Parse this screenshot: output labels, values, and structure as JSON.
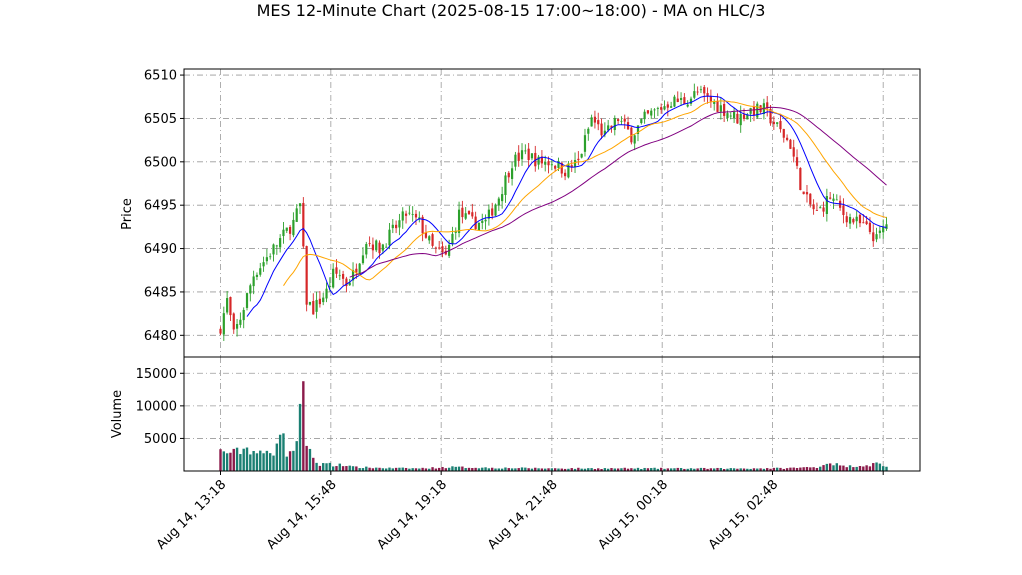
{
  "chart_data": {
    "type": "candlestick",
    "title": "MES 12-Minute Chart (2025-08-15 17:00~18:00) - MA on HLC/3",
    "price_panel": {
      "ylabel": "Price",
      "yticks": [
        6480,
        6485,
        6490,
        6495,
        6500,
        6505,
        6510
      ],
      "ylim": [
        6477.5,
        6510.7
      ],
      "grid": true
    },
    "volume_panel": {
      "ylabel": "Volume",
      "yticks": [
        5000,
        10000,
        15000
      ],
      "ylim": [
        0,
        17500
      ],
      "grid": true
    },
    "xticks": [
      "Aug 14, 13:18",
      "Aug 14, 15:48",
      "Aug 14, 19:18",
      "Aug 14, 21:48",
      "Aug 15, 00:18",
      "Aug 15, 02:48"
    ],
    "colors": {
      "up": "#2ca02c",
      "down": "#d62728",
      "volume_up": "#1a7f72",
      "volume_down": "#8b1a4a",
      "ma_fast": "#0000ff",
      "ma_mid": "#ffa500",
      "ma_slow": "#800080"
    },
    "close_anchors": [
      [
        0,
        6481
      ],
      [
        2,
        6484
      ],
      [
        4,
        6480
      ],
      [
        6,
        6482
      ],
      [
        10,
        6487
      ],
      [
        14,
        6489
      ],
      [
        18,
        6491
      ],
      [
        22,
        6493
      ],
      [
        24,
        6495
      ],
      [
        26,
        6484
      ],
      [
        28,
        6483
      ],
      [
        30,
        6484
      ],
      [
        32,
        6485
      ],
      [
        34,
        6487
      ],
      [
        36,
        6487
      ],
      [
        38,
        6486
      ],
      [
        40,
        6487
      ],
      [
        44,
        6491
      ],
      [
        48,
        6490
      ],
      [
        52,
        6492
      ],
      [
        56,
        6494
      ],
      [
        60,
        6493
      ],
      [
        64,
        6490
      ],
      [
        68,
        6489
      ],
      [
        72,
        6494
      ],
      [
        76,
        6493
      ],
      [
        80,
        6493
      ],
      [
        84,
        6496
      ],
      [
        88,
        6500
      ],
      [
        92,
        6501
      ],
      [
        96,
        6500
      ],
      [
        100,
        6500
      ],
      [
        104,
        6499
      ],
      [
        108,
        6500
      ],
      [
        112,
        6505
      ],
      [
        116,
        6503
      ],
      [
        120,
        6505
      ],
      [
        124,
        6503
      ],
      [
        128,
        6505
      ],
      [
        132,
        6506
      ],
      [
        136,
        6507
      ],
      [
        140,
        6507
      ],
      [
        144,
        6508
      ],
      [
        148,
        6507
      ],
      [
        152,
        6506
      ],
      [
        156,
        6505
      ],
      [
        160,
        6506
      ],
      [
        164,
        6506
      ],
      [
        168,
        6504
      ],
      [
        172,
        6502
      ],
      [
        176,
        6496
      ],
      [
        180,
        6494
      ],
      [
        184,
        6496
      ],
      [
        188,
        6494
      ],
      [
        192,
        6493
      ],
      [
        196,
        6492
      ],
      [
        198,
        6491
      ],
      [
        201,
        6493
      ]
    ],
    "volume_anchors": [
      [
        0,
        3000
      ],
      [
        4,
        2800
      ],
      [
        8,
        3500
      ],
      [
        12,
        2600
      ],
      [
        16,
        3000
      ],
      [
        18,
        6800
      ],
      [
        20,
        2800
      ],
      [
        22,
        3300
      ],
      [
        23,
        3800
      ],
      [
        24,
        12200
      ],
      [
        25,
        16000
      ],
      [
        26,
        3500
      ],
      [
        27,
        2800
      ],
      [
        28,
        1700
      ],
      [
        30,
        900
      ],
      [
        32,
        1400
      ],
      [
        34,
        700
      ],
      [
        36,
        1100
      ],
      [
        40,
        600
      ],
      [
        50,
        450
      ],
      [
        60,
        400
      ],
      [
        70,
        600
      ],
      [
        80,
        500
      ],
      [
        90,
        450
      ],
      [
        100,
        400
      ],
      [
        110,
        400
      ],
      [
        130,
        400
      ],
      [
        150,
        380
      ],
      [
        170,
        420
      ],
      [
        180,
        600
      ],
      [
        184,
        1300
      ],
      [
        188,
        700
      ],
      [
        196,
        900
      ],
      [
        198,
        1200
      ],
      [
        201,
        700
      ]
    ]
  }
}
